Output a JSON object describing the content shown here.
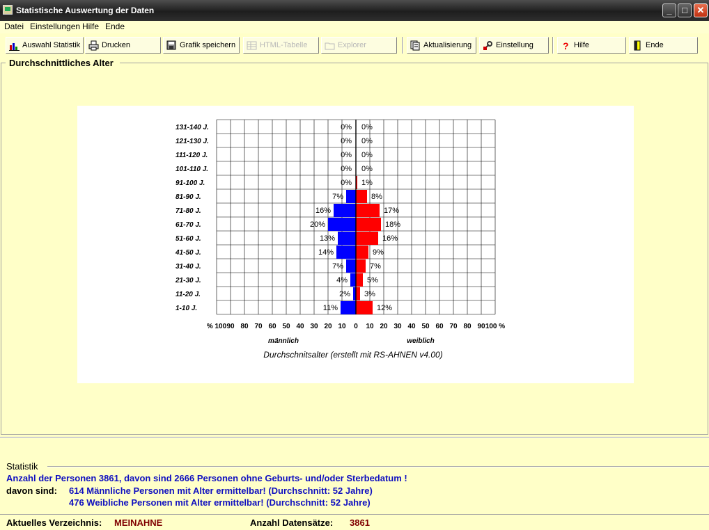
{
  "window": {
    "title": "Statistische Auswertung der Daten",
    "min_label": "_",
    "max_label": "□",
    "close_label": "✕"
  },
  "menu": [
    "Datei",
    "Einstellungen",
    "Hilfe",
    "Ende"
  ],
  "toolbar": {
    "buttons": [
      {
        "label": "Auswahl Statistik",
        "icon": "chart-icon",
        "enabled": true
      },
      {
        "label": "Drucken",
        "icon": "printer-icon",
        "enabled": true
      },
      {
        "label": "Grafik speichern",
        "icon": "save-graphic-icon",
        "enabled": true
      },
      {
        "label": "HTML-Tabelle",
        "icon": "table-icon",
        "enabled": false
      },
      {
        "label": "Explorer",
        "icon": "explorer-icon",
        "enabled": false
      },
      {
        "label": "Aktualisierung",
        "icon": "refresh-icon",
        "enabled": true
      },
      {
        "label": "Einstellung",
        "icon": "settings-icon",
        "enabled": true
      },
      {
        "label": "Hilfe",
        "icon": "help-icon",
        "enabled": true
      },
      {
        "label": "Ende",
        "icon": "exit-icon",
        "enabled": true
      }
    ]
  },
  "main_panel": {
    "label": "Durchschnittliches Alter"
  },
  "chart_data": {
    "type": "bar",
    "orientation": "horizontal-population-pyramid",
    "categories": [
      "131-140 J.",
      "121-130 J.",
      "111-120 J.",
      "101-110 J.",
      "91-100 J.",
      "81-90 J.",
      "71-80 J.",
      "61-70 J.",
      "51-60 J.",
      "41-50 J.",
      "31-40 J.",
      "21-30 J.",
      "11-20 J.",
      "1-10 J."
    ],
    "series": [
      {
        "name": "männlich",
        "color": "#0000ff",
        "values": [
          0,
          0,
          0,
          0,
          0,
          7,
          16,
          20,
          13,
          14,
          7,
          4,
          2,
          11
        ]
      },
      {
        "name": "weiblich",
        "color": "#ff0000",
        "values": [
          0,
          0,
          0,
          0,
          1,
          8,
          17,
          18,
          16,
          9,
          7,
          5,
          3,
          12
        ]
      }
    ],
    "x_ticks": [
      "% 100",
      "90",
      "80",
      "70",
      "60",
      "50",
      "40",
      "30",
      "20",
      "10",
      "0",
      "10",
      "20",
      "30",
      "40",
      "50",
      "60",
      "70",
      "80",
      "90",
      "100 %"
    ],
    "xlim": [
      -100,
      100
    ],
    "left_label": "männlich",
    "right_label": "weiblich",
    "title": "Durchschnitsalter (erstellt mit RS-AHNEN v4.00)",
    "grid": true
  },
  "statistik": {
    "label": "Statistik",
    "line1": "Anzahl der Personen 3861, davon sind 2666 Personen ohne Geburts- und/oder Sterbedatum !",
    "davon_label": "davon sind:",
    "line2": "614 Männliche Personen mit Alter ermittelbar!  (Durchschnitt: 52 Jahre)",
    "line3": "476 Weibliche Personen mit Alter ermittelbar!  (Durchschnitt: 52 Jahre)"
  },
  "status": {
    "dir_label": "Aktuelles Verzeichnis:",
    "dir_value": "MEINAHNE",
    "count_label": "Anzahl Datensätze:",
    "count_value": "3861"
  }
}
